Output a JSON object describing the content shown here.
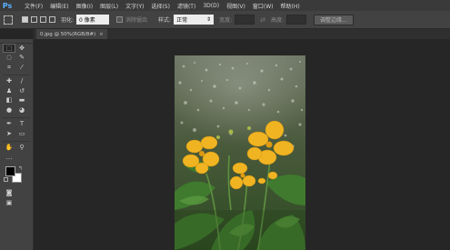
{
  "app": {
    "logo": "Ps"
  },
  "menu": [
    "文件(F)",
    "编辑(E)",
    "图像(I)",
    "图层(L)",
    "文字(Y)",
    "选择(S)",
    "滤镜(T)",
    "3D(D)",
    "视图(V)",
    "窗口(W)",
    "帮助(H)"
  ],
  "options": {
    "feather_label": "羽化:",
    "feather_value": "0 像素",
    "antialias_label": "消除锯齿",
    "style_label": "样式:",
    "style_value": "正常",
    "width_label": "宽度:",
    "height_label": "高度:",
    "refine_edge_label": "调整边缘..."
  },
  "document": {
    "tab_title": "0.jpg @ 50%(RGB/8#)",
    "close_glyph": "×"
  },
  "icons": {
    "tool_marquee": "marquee-icon",
    "tool_move": "move-icon",
    "color_fg": "#000000",
    "color_bg": "#ffffff"
  }
}
